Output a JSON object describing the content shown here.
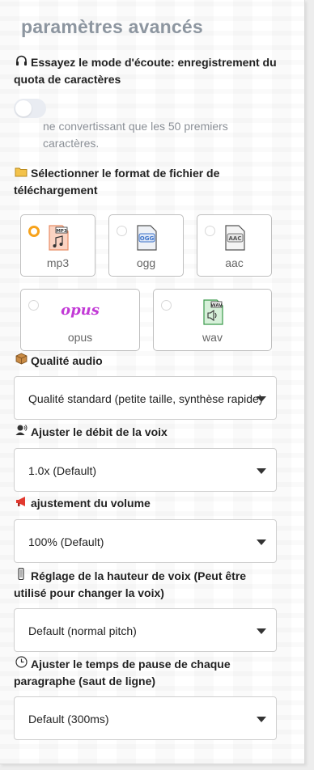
{
  "title": "paramètres avancés",
  "listen_mode": {
    "label": "Essayez le mode d'écoute: enregistrement du quota de caractères",
    "icon": "headphones-icon",
    "toggle_on": false,
    "hint": "ne convertissant que les 50 premiers caractères."
  },
  "file_format": {
    "label": "Sélectionner le format de fichier de téléchargement",
    "icon": "folder-icon",
    "selected": "mp3",
    "options": [
      {
        "name": "mp3",
        "badge": "MP3",
        "color": "#f2a98a"
      },
      {
        "name": "ogg",
        "badge": "OGG",
        "color": "#3d73c9"
      },
      {
        "name": "aac",
        "badge": "AAC",
        "color": "#666666"
      },
      {
        "name": "opus",
        "badge": "opus",
        "color": "#c23ad6"
      },
      {
        "name": "wav",
        "badge": "WAV",
        "color": "#3a9a4a"
      }
    ]
  },
  "audio_quality": {
    "label": "Qualité audio",
    "icon": "package-icon",
    "value": "Qualité standard (petite taille, synthèse rapide)"
  },
  "voice_rate": {
    "label": "Ajuster le débit de la voix",
    "icon": "speaker-person-icon",
    "value": "1.0x (Default)"
  },
  "volume": {
    "label": "ajustement du volume",
    "icon": "megaphone-icon",
    "value": "100% (Default)"
  },
  "pitch": {
    "label": "Réglage de la hauteur de voix (Peut être utilisé pour changer la voix)",
    "icon": "thermometer-icon",
    "value": "Default (normal pitch)"
  },
  "pause": {
    "label": "Ajuster le temps de pause de chaque paragraphe (saut de ligne)",
    "icon": "clock-icon",
    "value": "Default (300ms)"
  }
}
